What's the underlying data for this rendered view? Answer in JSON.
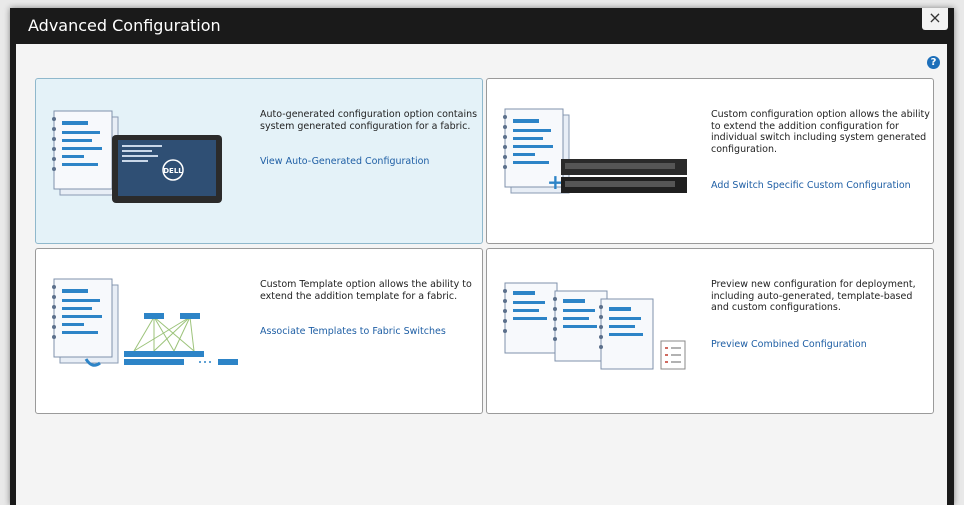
{
  "dialog": {
    "title": "Advanced Configuration",
    "close_label": "×",
    "help_label": "?"
  },
  "cards": [
    {
      "description": "Auto-generated configuration option contains system generated configuration for a fabric.",
      "link": "View Auto-Generated Configuration",
      "icon": "document-tablet-icon",
      "tablet_brand": "DELL"
    },
    {
      "description": "Custom configuration option allows the ability to extend the addition configuration for individual switch including system generated configuration.",
      "link": "Add Switch Specific Custom Configuration",
      "icon": "document-switch-icon"
    },
    {
      "description": "Custom Template option allows the ability to extend the addition template for a fabric.",
      "link": "Associate Templates to Fabric Switches",
      "icon": "document-topology-icon"
    },
    {
      "description": "Preview new configuration for deployment, including auto-generated, template-based and custom configurations.",
      "link": "Preview Combined Configuration",
      "icon": "documents-checklist-icon"
    }
  ],
  "colors": {
    "title_bar": "#1a1a1a",
    "selected_card": "#e4f2f8",
    "link": "#1f5fa5",
    "help": "#1d6fba"
  }
}
